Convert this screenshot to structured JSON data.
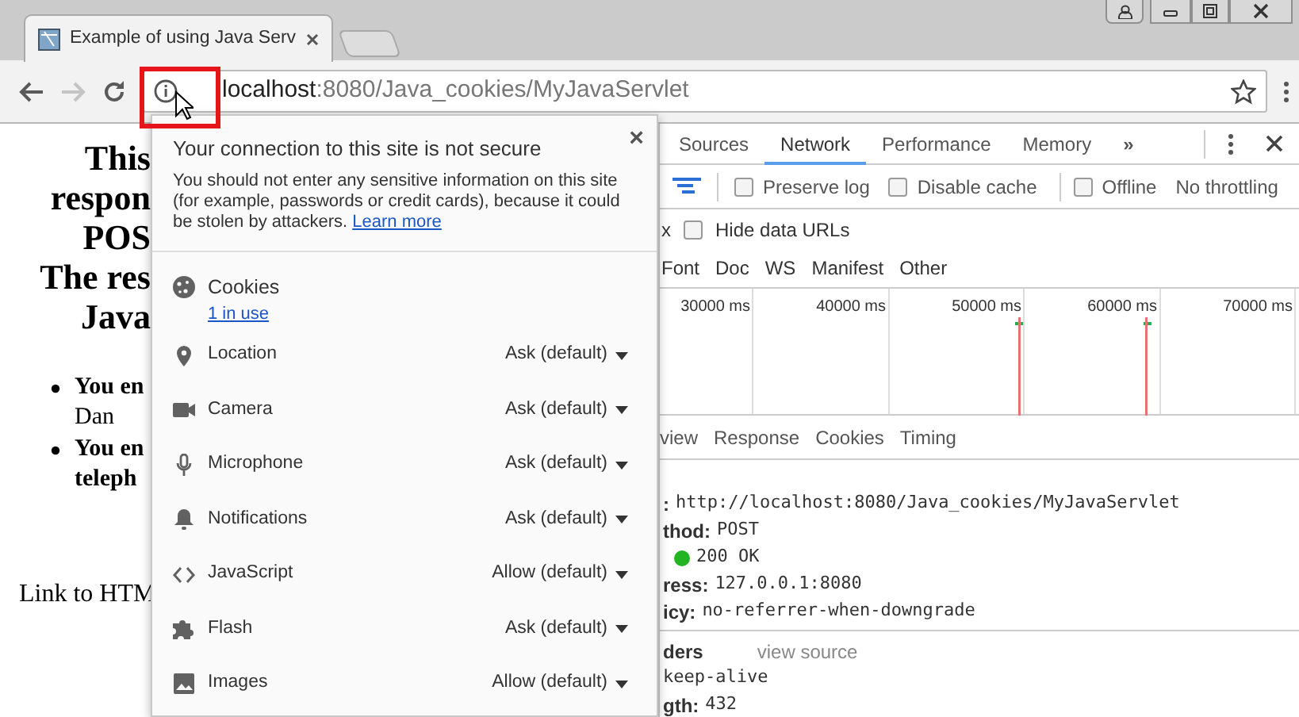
{
  "browser": {
    "tab": {
      "title": "Example of using Java Serv"
    },
    "address": {
      "host": "localhost",
      "rest": ":8080/Java_cookies/MyJavaServlet"
    },
    "forward_disabled": true
  },
  "page": {
    "heading_lines": [
      "This",
      "respon",
      "POS",
      "The res",
      "Java"
    ],
    "bullets": [
      {
        "lines": [
          {
            "text": "You en",
            "bold": true
          },
          {
            "text": "Dan",
            "bold": false
          }
        ]
      },
      {
        "lines": [
          {
            "text": "You en",
            "bold": true
          },
          {
            "text": "teleph",
            "bold": true
          }
        ]
      }
    ],
    "link": "Link to HTM"
  },
  "site_info": {
    "title": "Your connection to this site is not secure",
    "message": "You should not enter any sensitive information on this site (for example, passwords or credit cards), because it could be stolen by attackers.",
    "learn_more": "Learn more",
    "close": "×",
    "cookies": {
      "label": "Cookies",
      "link": "1 in use"
    },
    "permissions": [
      {
        "kind": "location",
        "label": "Location",
        "value": "Ask (default)"
      },
      {
        "kind": "camera",
        "label": "Camera",
        "value": "Ask (default)"
      },
      {
        "kind": "microphone",
        "label": "Microphone",
        "value": "Ask (default)"
      },
      {
        "kind": "notifications",
        "label": "Notifications",
        "value": "Ask (default)"
      },
      {
        "kind": "javascript",
        "label": "JavaScript",
        "value": "Allow (default)"
      },
      {
        "kind": "flash",
        "label": "Flash",
        "value": "Ask (default)"
      },
      {
        "kind": "images",
        "label": "Images",
        "value": "Allow (default)"
      }
    ]
  },
  "devtools": {
    "tabs": [
      {
        "label": "Sources",
        "selected": false
      },
      {
        "label": "Network",
        "selected": true
      },
      {
        "label": "Performance",
        "selected": false
      },
      {
        "label": "Memory",
        "selected": false
      }
    ],
    "more": "»",
    "options": [
      {
        "label": "Preserve log",
        "checked": false
      },
      {
        "label": "Disable cache",
        "checked": false
      },
      {
        "label": "Offline",
        "checked": false
      }
    ],
    "throttling": "No throttling",
    "filter_fragment": "x",
    "hide_data_urls": {
      "label": "Hide data URLs",
      "checked": false
    },
    "types": [
      "Font",
      "Doc",
      "WS",
      "Manifest",
      "Other"
    ],
    "ticks": [
      "30000 ms",
      "40000 ms",
      "50000 ms",
      "60000 ms",
      "70000 ms"
    ],
    "detail_tabs": [
      "view",
      "Response",
      "Cookies",
      "Timing"
    ],
    "general": [
      {
        "label": ":",
        "value": "http://localhost:8080/Java_cookies/MyJavaServlet",
        "kind": "text"
      },
      {
        "label": "thod:",
        "value": "POST",
        "kind": "text"
      },
      {
        "value": "200 OK",
        "kind": "status",
        "color": "#22b422"
      },
      {
        "label": "ress:",
        "value": "127.0.0.1:8080",
        "kind": "text"
      },
      {
        "label": "icy:",
        "value": "no-referrer-when-downgrade",
        "kind": "text"
      }
    ],
    "headers_title": "ders",
    "view_source": "view source",
    "headers": [
      {
        "value": "keep-alive"
      },
      {
        "label": "gth:",
        "value": "432"
      }
    ]
  }
}
